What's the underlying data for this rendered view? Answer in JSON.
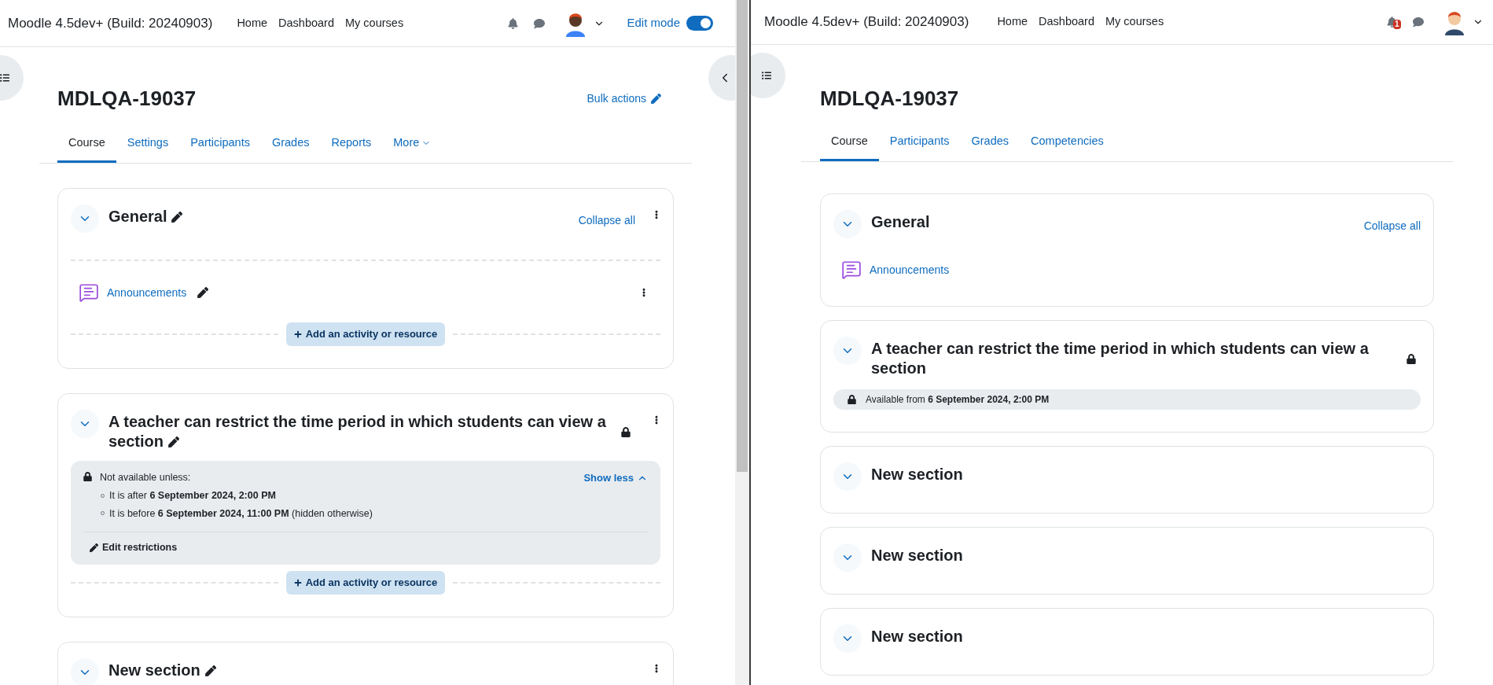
{
  "panes": [
    {
      "header": {
        "site_name": "Moodle 4.5dev+ (Build: 20240903)",
        "nav": [
          "Home",
          "Dashboard",
          "My courses"
        ],
        "edit_toggle": {
          "label": "Edit mode",
          "on": true
        }
      },
      "editing": true,
      "course_title": "MDLQA-19037",
      "bulk_actions": "Bulk actions",
      "tabs": [
        {
          "label": "Course",
          "selected": true
        },
        {
          "label": "Settings",
          "selected": false
        },
        {
          "label": "Participants",
          "selected": false
        },
        {
          "label": "Grades",
          "selected": false
        },
        {
          "label": "Reports",
          "selected": false
        },
        {
          "label": "More",
          "selected": false,
          "kind": "menu"
        }
      ],
      "sections": [
        {
          "title": "General",
          "expanded": true,
          "collapse_all": "Collapse all",
          "activities": [
            {
              "name": "Announcements"
            }
          ],
          "add_button": "Add an activity or resource"
        },
        {
          "title": "A teacher can restrict the time period in which students can view a section",
          "expanded": true,
          "restricted": true,
          "restrictions": {
            "heading": "Not available unless:",
            "items": [
              "It is after **6 September 2024, 2:00 PM**",
              "It is before **6 September 2024, 11:00 PM** (hidden otherwise)"
            ],
            "toggle": "Show less",
            "edit": "Edit restrictions"
          },
          "add_button": "Add an activity or resource"
        },
        {
          "title": "New section",
          "expanded": true
        }
      ]
    },
    {
      "header": {
        "site_name": "Moodle 4.5dev+ (Build: 20240903)",
        "nav": [
          "Home",
          "Dashboard",
          "My courses"
        ],
        "notification_badge": "1"
      },
      "editing": false,
      "course_title": "MDLQA-19037",
      "tabs": [
        {
          "label": "Course",
          "selected": true
        },
        {
          "label": "Participants",
          "selected": false
        },
        {
          "label": "Grades",
          "selected": false
        },
        {
          "label": "Competencies",
          "selected": false
        }
      ],
      "sections": [
        {
          "title": "General",
          "expanded": true,
          "collapse_all": "Collapse all",
          "activities": [
            {
              "name": "Announcements"
            }
          ]
        },
        {
          "title": "A teacher can restrict the time period in which students can view a section",
          "expanded": true,
          "restricted": true,
          "availability": "Available from **6 September 2024, 2:00 PM**"
        },
        {
          "title": "New section",
          "expanded": true
        },
        {
          "title": "New section",
          "expanded": true
        },
        {
          "title": "New section",
          "expanded": true
        }
      ]
    }
  ]
}
